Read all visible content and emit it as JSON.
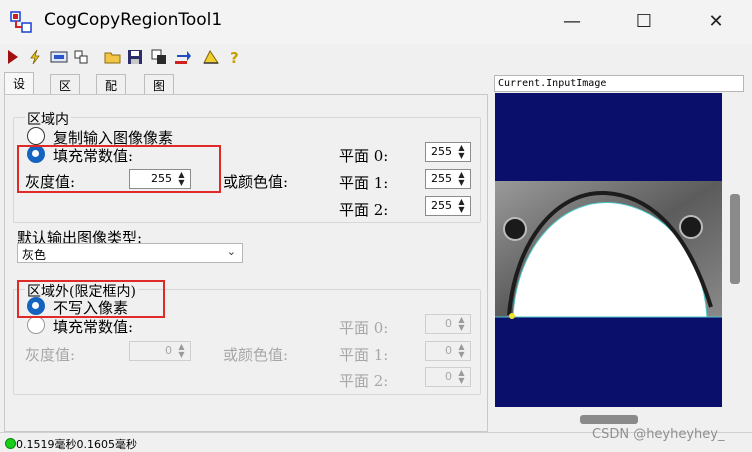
{
  "window": {
    "title": "CogCopyRegionTool1",
    "minimize": "—",
    "maximize": "☐",
    "close": "✕"
  },
  "toolbar": {
    "icons": [
      "run-icon",
      "electric-run-icon",
      "show-io-icon",
      "edit-icon",
      "open-icon",
      "save-icon",
      "settings-icon",
      "reset-icon",
      "measure-icon",
      "help-icon"
    ]
  },
  "tabs": [
    "设置",
    "区域",
    "配对",
    "图形"
  ],
  "inside": {
    "label": "区域内",
    "option_copy": "复制输入图像像素",
    "option_fill": "填充常数值:",
    "gray_label": "灰度值:",
    "gray_value": "255",
    "or_color": "或颜色值:",
    "planes": [
      {
        "label": "平面  0:",
        "value": "255"
      },
      {
        "label": "平面  1:",
        "value": "255"
      },
      {
        "label": "平面  2:",
        "value": "255"
      }
    ]
  },
  "default_output": {
    "label": "默认输出图像类型:",
    "value": "灰色"
  },
  "outside": {
    "label": "区域外(限定框内)",
    "option_nowrite": "不写入像素",
    "option_fill": "填充常数值:",
    "gray_label": "灰度值:",
    "gray_value": "0",
    "or_color": "或颜色值:",
    "planes": [
      {
        "label": "平面  0:",
        "value": "0"
      },
      {
        "label": "平面  1:",
        "value": "0"
      },
      {
        "label": "平面  2:",
        "value": "0"
      }
    ]
  },
  "image_panel": {
    "label": "Current.InputImage"
  },
  "status": {
    "text": "0.1519毫秒0.1605毫秒"
  },
  "watermark": "CSDN @heyheyhey_",
  "colors": {
    "viewer_bg": "#0a0f6c",
    "highlight": "#e02a2a",
    "radio_checked": "#1463c0",
    "led": "#18d018"
  }
}
